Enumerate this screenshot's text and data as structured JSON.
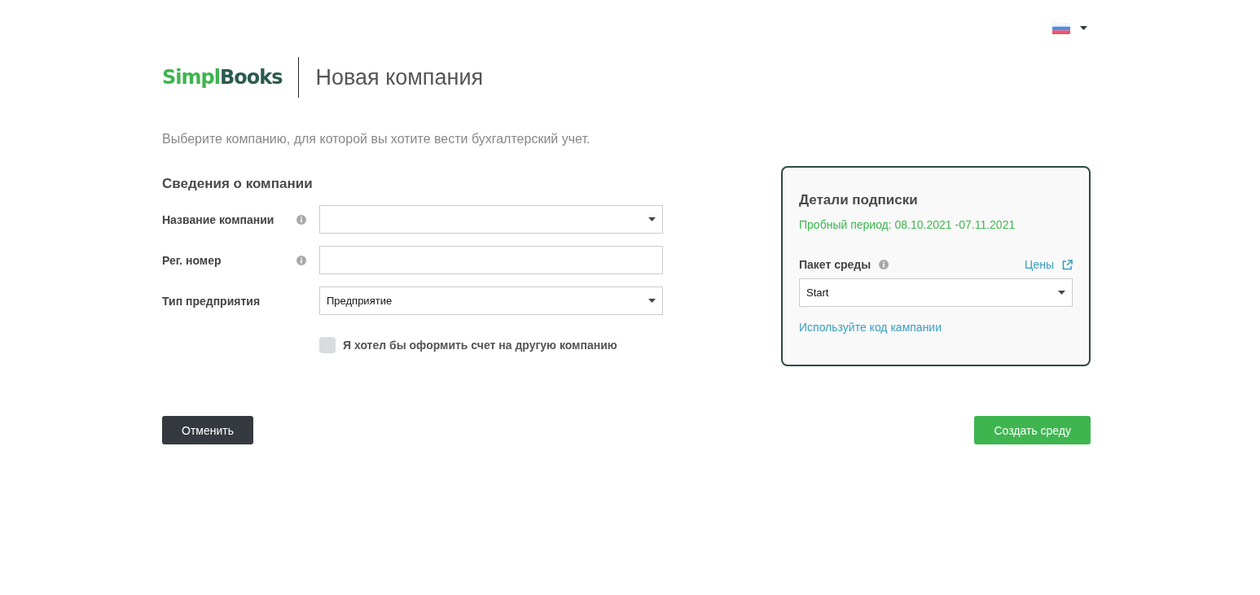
{
  "header": {
    "logo": {
      "part1": "Simpl",
      "part2": "Books"
    },
    "title": "Новая компания"
  },
  "intro": "Выберите компанию, для которой вы хотите вести бухгалтерский учет.",
  "company_form": {
    "title": "Сведения о компании",
    "fields": [
      {
        "label": "Название компании",
        "info": true,
        "kind": "select"
      },
      {
        "label": "Рег. номер",
        "info": true,
        "kind": "text"
      },
      {
        "label": "Тип предприятия",
        "info": false,
        "kind": "select",
        "value": "Предприятие"
      }
    ],
    "checkbox": {
      "label": "Я хотел бы оформить счет на другую компанию",
      "checked": false
    }
  },
  "subscription": {
    "title": "Детали подписки",
    "trial": "Пробный период: 08.10.2021 -07.11.2021",
    "package_label": "Пакет среды",
    "prices_link": "Цены",
    "package_value": "Start",
    "campaign_link": "Используйте код кампании"
  },
  "buttons": {
    "cancel": "Отменить",
    "create": "Создать среду"
  }
}
